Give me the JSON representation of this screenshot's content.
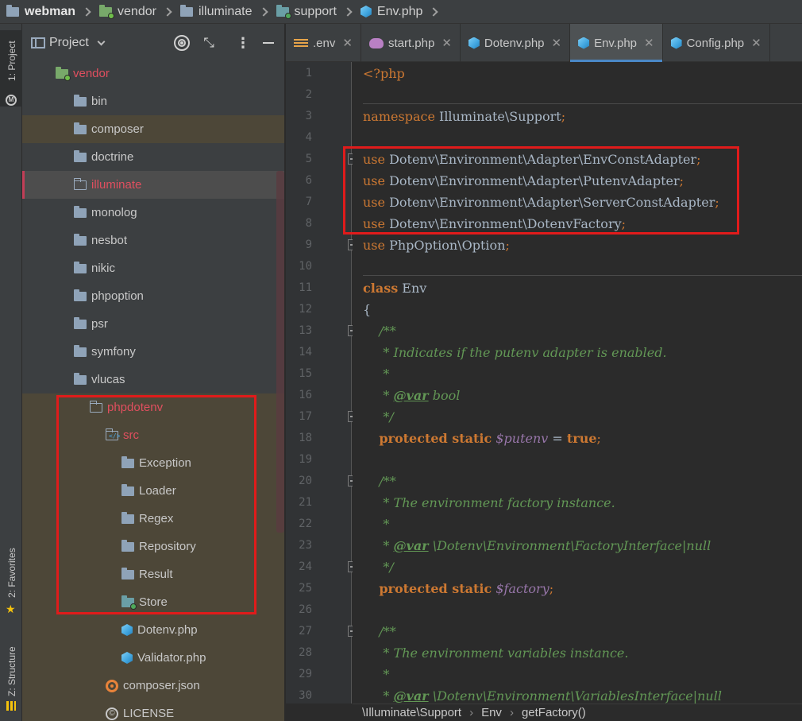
{
  "breadcrumb": [
    "webman",
    "vendor",
    "illuminate",
    "support",
    "Env.php"
  ],
  "left_strip": {
    "project": "1: Project",
    "favorites": "2: Favorites",
    "structure": "Z: Structure"
  },
  "project_panel": {
    "title": "Project",
    "tree": [
      {
        "label": "vendor",
        "level": 1,
        "state": "open",
        "icon": "folder-green",
        "color": "red"
      },
      {
        "label": "bin",
        "level": 2,
        "state": "closed",
        "icon": "folder"
      },
      {
        "label": "composer",
        "level": 2,
        "state": "closed",
        "icon": "folder",
        "highlight": "brown"
      },
      {
        "label": "doctrine",
        "level": 2,
        "state": "closed",
        "icon": "folder"
      },
      {
        "label": "illuminate",
        "level": 2,
        "state": "closed",
        "icon": "folder-outline",
        "color": "red",
        "selected": true
      },
      {
        "label": "monolog",
        "level": 2,
        "state": "closed",
        "icon": "folder"
      },
      {
        "label": "nesbot",
        "level": 2,
        "state": "closed",
        "icon": "folder"
      },
      {
        "label": "nikic",
        "level": 2,
        "state": "closed",
        "icon": "folder"
      },
      {
        "label": "phpoption",
        "level": 2,
        "state": "closed",
        "icon": "folder"
      },
      {
        "label": "psr",
        "level": 2,
        "state": "closed",
        "icon": "folder"
      },
      {
        "label": "symfony",
        "level": 2,
        "state": "closed",
        "icon": "folder"
      },
      {
        "label": "vlucas",
        "level": 2,
        "state": "open",
        "icon": "folder"
      },
      {
        "label": "phpdotenv",
        "level": 3,
        "state": "open",
        "icon": "folder-outline",
        "color": "red"
      },
      {
        "label": "src",
        "level": 4,
        "state": "open",
        "icon": "folder-src",
        "color": "red"
      },
      {
        "label": "Exception",
        "level": 5,
        "state": "closed",
        "icon": "folder"
      },
      {
        "label": "Loader",
        "level": 5,
        "state": "closed",
        "icon": "folder"
      },
      {
        "label": "Regex",
        "level": 5,
        "state": "closed",
        "icon": "folder"
      },
      {
        "label": "Repository",
        "level": 5,
        "state": "closed",
        "icon": "folder"
      },
      {
        "label": "Result",
        "level": 5,
        "state": "closed",
        "icon": "folder"
      },
      {
        "label": "Store",
        "level": 5,
        "state": "closed",
        "icon": "folder-teal"
      },
      {
        "label": "Dotenv.php",
        "level": 5,
        "state": "none",
        "icon": "php-file"
      },
      {
        "label": "Validator.php",
        "level": 5,
        "state": "none",
        "icon": "php-file"
      },
      {
        "label": "composer.json",
        "level": 4,
        "state": "none",
        "icon": "json-file"
      },
      {
        "label": "LICENSE",
        "level": 4,
        "state": "none",
        "icon": "license-file"
      }
    ]
  },
  "editor_tabs": [
    {
      "label": ".env",
      "icon": "env-file-icon",
      "active": false
    },
    {
      "label": "start.php",
      "icon": "php-elephant-icon",
      "active": false
    },
    {
      "label": "Dotenv.php",
      "icon": "php-class-icon",
      "active": false
    },
    {
      "label": "Env.php",
      "icon": "php-class-icon",
      "active": true
    },
    {
      "label": "Config.php",
      "icon": "php-class-icon",
      "active": false
    }
  ],
  "code_lines": [
    [
      [
        "tag-open",
        "<?php"
      ]
    ],
    [],
    [
      [
        "kwn",
        "namespace"
      ],
      [
        "t",
        " Illuminate\\Support"
      ],
      [
        "semi",
        ";"
      ]
    ],
    [],
    [
      [
        "kwn",
        "use"
      ],
      [
        "t",
        " Dotenv\\Environment\\Adapter\\EnvConstAdapter"
      ],
      [
        "semi",
        ";"
      ]
    ],
    [
      [
        "kwn",
        "use"
      ],
      [
        "t",
        " Dotenv\\Environment\\Adapter\\PutenvAdapter"
      ],
      [
        "semi",
        ";"
      ]
    ],
    [
      [
        "kwn",
        "use"
      ],
      [
        "t",
        " Dotenv\\Environment\\Adapter\\ServerConstAdapter"
      ],
      [
        "semi",
        ";"
      ]
    ],
    [
      [
        "kwn",
        "use"
      ],
      [
        "t",
        " Dotenv\\Environment\\DotenvFactory"
      ],
      [
        "semi",
        ";"
      ]
    ],
    [
      [
        "kwn",
        "use"
      ],
      [
        "t",
        " PhpOption\\Option"
      ],
      [
        "semi",
        ";"
      ]
    ],
    [],
    [
      [
        "kw",
        "class"
      ],
      [
        "t",
        " Env"
      ]
    ],
    [
      [
        "t",
        "{"
      ]
    ],
    [
      [
        "t",
        "    "
      ],
      [
        "cm",
        "/**"
      ]
    ],
    [
      [
        "cm",
        "     * Indicates if the putenv adapter is enabled."
      ]
    ],
    [
      [
        "cm",
        "     *"
      ]
    ],
    [
      [
        "cm",
        "     * "
      ],
      [
        "tag",
        "@var"
      ],
      [
        "cm",
        " bool"
      ]
    ],
    [
      [
        "cm",
        "     */"
      ]
    ],
    [
      [
        "t",
        "    "
      ],
      [
        "kw",
        "protected static"
      ],
      [
        "var",
        " $putenv"
      ],
      [
        "t",
        " = "
      ],
      [
        "kw",
        "true"
      ],
      [
        "semi",
        ";"
      ]
    ],
    [],
    [
      [
        "t",
        "    "
      ],
      [
        "cm",
        "/**"
      ]
    ],
    [
      [
        "cm",
        "     * The environment factory instance."
      ]
    ],
    [
      [
        "cm",
        "     *"
      ]
    ],
    [
      [
        "cm",
        "     * "
      ],
      [
        "tag",
        "@var"
      ],
      [
        "cm",
        " \\Dotenv\\Environment\\FactoryInterface|null"
      ]
    ],
    [
      [
        "cm",
        "     */"
      ]
    ],
    [
      [
        "t",
        "    "
      ],
      [
        "kw",
        "protected static"
      ],
      [
        "var",
        " $factory"
      ],
      [
        "semi",
        ";"
      ]
    ],
    [],
    [
      [
        "t",
        "    "
      ],
      [
        "cm",
        "/**"
      ]
    ],
    [
      [
        "cm",
        "     * The environment variables instance."
      ]
    ],
    [
      [
        "cm",
        "     *"
      ]
    ],
    [
      [
        "cm",
        "     * "
      ],
      [
        "tag",
        "@var"
      ],
      [
        "cm",
        " \\Dotenv\\Environment\\VariablesInterface|null"
      ]
    ]
  ],
  "line_numbers": [
    "1",
    "2",
    "3",
    "4",
    "5",
    "6",
    "7",
    "8",
    "9",
    "10",
    "11",
    "12",
    "13",
    "14",
    "15",
    "16",
    "17",
    "18",
    "19",
    "20",
    "21",
    "22",
    "23",
    "24",
    "25",
    "26",
    "27",
    "28",
    "29",
    "30"
  ],
  "status_breadcrumb": [
    "\\Illuminate\\Support",
    "Env",
    "getFactory()"
  ]
}
